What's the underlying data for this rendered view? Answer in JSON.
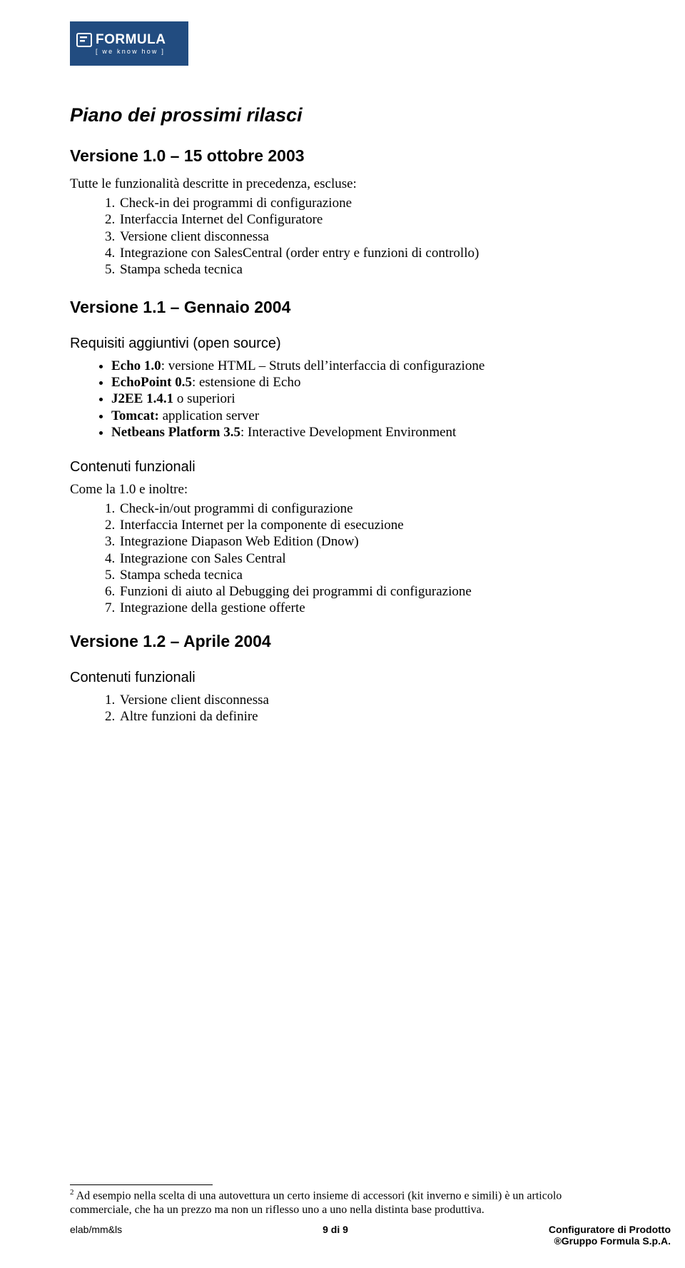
{
  "logo": {
    "brand": "FORMULA",
    "tag": "[ we know how ]"
  },
  "h1": "Piano dei prossimi rilasci",
  "v10": {
    "heading": "Versione 1.0 – 15 ottobre 2003",
    "intro": "Tutte le funzionalità descritte in precedenza, escluse:",
    "items": [
      "Check-in dei programmi di configurazione",
      "Interfaccia Internet del Configuratore",
      "Versione client disconnessa",
      "Integrazione con SalesCentral (order entry e funzioni di controllo)",
      "Stampa scheda tecnica"
    ]
  },
  "v11": {
    "heading": "Versione 1.1 – Gennaio 2004",
    "reqHeading": "Requisiti aggiuntivi (open source)",
    "bullets": {
      "echo_label": "Echo 1.0",
      "echo_rest": ": versione HTML – Struts dell’interfaccia di configurazione",
      "echopoint_label": "EchoPoint 0.5",
      "echopoint_rest": ": estensione di Echo",
      "j2ee_label": "J2EE 1.4.1",
      "j2ee_rest": " o superiori",
      "tomcat_label": "Tomcat:",
      "tomcat_rest": " application server",
      "netbeans_label": "Netbeans Platform 3.5",
      "netbeans_rest": ": Interactive Development Environment"
    },
    "contHeading": "Contenuti funzionali",
    "contIntro": "Come la 1.0 e inoltre:",
    "items": [
      "Check-in/out  programmi di configurazione",
      "Interfaccia Internet per la componente di esecuzione",
      "Integrazione Diapason Web Edition (Dnow)",
      "Integrazione con Sales Central",
      "Stampa scheda tecnica",
      "Funzioni di aiuto al Debugging dei programmi di configurazione",
      "Integrazione della gestione offerte"
    ]
  },
  "v12": {
    "heading": "Versione 1.2 – Aprile 2004",
    "contHeading": "Contenuti funzionali",
    "items": [
      "Versione client disconnessa",
      "Altre funzioni da definire"
    ]
  },
  "footnote": {
    "marker": "2",
    "text": " Ad esempio nella scelta di una autovettura un certo insieme di accessori (kit inverno e simili) è un articolo commerciale, che ha un prezzo ma non un riflesso uno a uno nella distinta base produttiva."
  },
  "footer": {
    "left": "elab/mm&ls",
    "center": "9 di 9",
    "right1": "Configuratore di Prodotto",
    "right2": "®Gruppo Formula S.p.A."
  }
}
